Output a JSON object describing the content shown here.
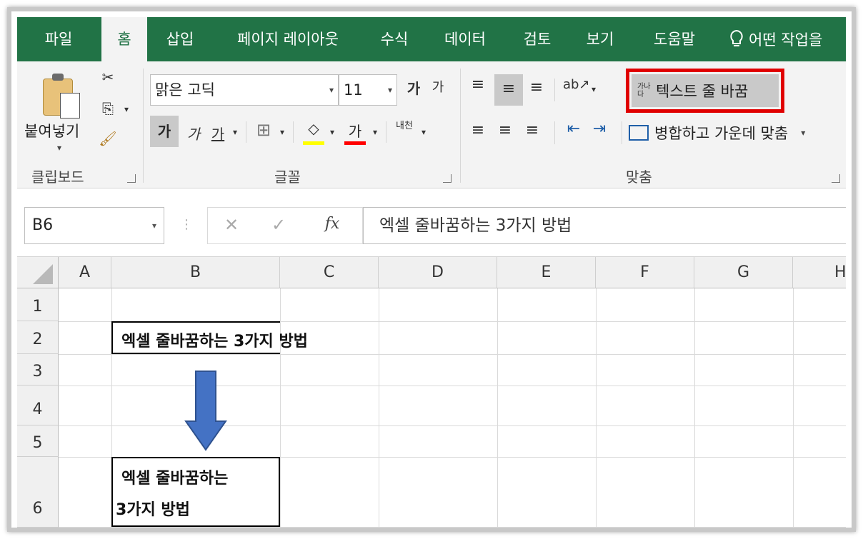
{
  "tabs": [
    {
      "label": "파일",
      "active": false
    },
    {
      "label": "홈",
      "active": true
    },
    {
      "label": "삽입",
      "active": false
    },
    {
      "label": "페이지 레이아웃",
      "active": false
    },
    {
      "label": "수식",
      "active": false
    },
    {
      "label": "데이터",
      "active": false
    },
    {
      "label": "검토",
      "active": false
    },
    {
      "label": "보기",
      "active": false
    },
    {
      "label": "도움말",
      "active": false
    }
  ],
  "tell_me": "어떤 작업을",
  "clipboard": {
    "paste_label": "붙여넣기",
    "group_label": "클립보드"
  },
  "font": {
    "name": "맑은 고딕",
    "size": "11",
    "grow_glyph": "가",
    "shrink_glyph": "가",
    "bold_glyph": "가",
    "italic_glyph": "가",
    "underline_glyph": "가",
    "font_color_glyph": "가",
    "phonetic_glyph": "내천",
    "group_label": "글꼴",
    "fill_color": "#ffff00",
    "font_color": "#ff0000"
  },
  "alignment": {
    "wrap_text_label": "텍스트 줄 바꿈",
    "wrap_icon_text": "가나다",
    "merge_label": "병합하고 가운데 맞춤",
    "group_label": "맞춤",
    "highlight_color": "#e00000"
  },
  "formula_bar": {
    "name_box": "B6",
    "fx": "fx",
    "content": "엑셀 줄바꿈하는 3가지 방법"
  },
  "columns": [
    "A",
    "B",
    "C",
    "D",
    "E",
    "F",
    "G",
    "H"
  ],
  "rows": [
    "1",
    "2",
    "3",
    "4",
    "5",
    "6"
  ],
  "cells": {
    "b2": "엑셀 줄바꿈하는 3가지 방법",
    "b6_line1": "엑셀 줄바꿈하는",
    "b6_line2": "3가지 방법"
  },
  "arrow_color": "#4472c4",
  "theme_green": "#217346"
}
